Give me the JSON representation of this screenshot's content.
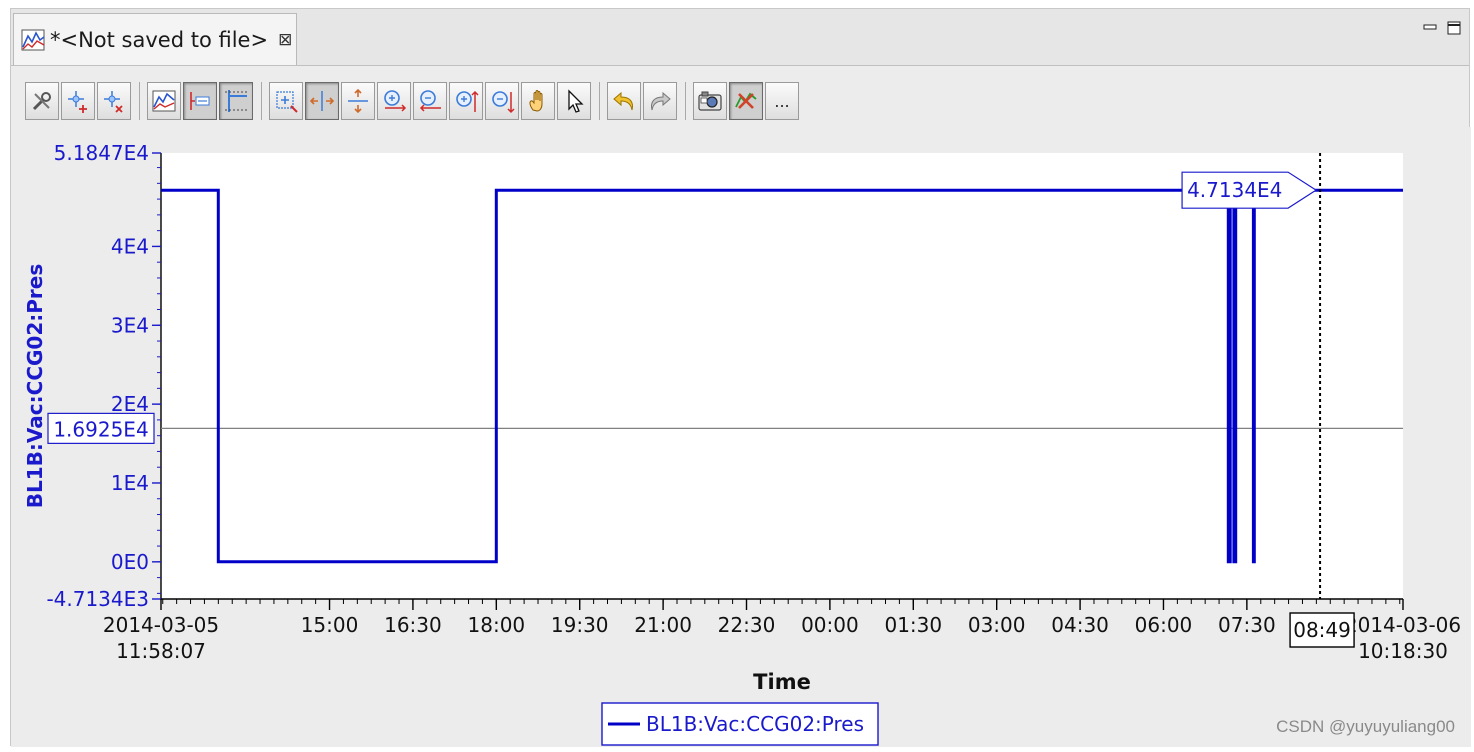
{
  "tab": {
    "title": "*<Not saved to file>",
    "close_glyph": "⊠"
  },
  "toolbar": {
    "more_label": "..."
  },
  "colors": {
    "trace": "#0000c8",
    "axis_text": "#1a1acc",
    "grid_line": "#808080"
  },
  "watermark": "CSDN @yuyuyuliang00",
  "chart_data": {
    "type": "line",
    "xlabel": "Time",
    "ylabel": "BL1B:Vac:CCG02:Pres",
    "ylim": [
      -4713.4,
      51847
    ],
    "y_ticks": [
      {
        "value": 51847,
        "label": "5.1847E4"
      },
      {
        "value": 40000,
        "label": "4E4"
      },
      {
        "value": 30000,
        "label": "3E4"
      },
      {
        "value": 20000,
        "label": "2E4"
      },
      {
        "value": 10000,
        "label": "1E4"
      },
      {
        "value": 0,
        "label": "0E0"
      },
      {
        "value": -4713.4,
        "label": "-4.7134E3"
      }
    ],
    "xlim": [
      "2014-03-05 11:58:07",
      "2014-03-06 10:18:30"
    ],
    "x_ticks": [
      {
        "time": "2014-03-05 11:58:07",
        "label": "2014-03-05",
        "label2": "11:58:07"
      },
      {
        "time": "2014-03-05 15:00",
        "label": "15:00"
      },
      {
        "time": "2014-03-05 16:30",
        "label": "16:30"
      },
      {
        "time": "2014-03-05 18:00",
        "label": "18:00"
      },
      {
        "time": "2014-03-05 19:30",
        "label": "19:30"
      },
      {
        "time": "2014-03-05 21:00",
        "label": "21:00"
      },
      {
        "time": "2014-03-05 22:30",
        "label": "22:30"
      },
      {
        "time": "2014-03-06 00:00",
        "label": "00:00"
      },
      {
        "time": "2014-03-06 01:30",
        "label": "01:30"
      },
      {
        "time": "2014-03-06 03:00",
        "label": "03:00"
      },
      {
        "time": "2014-03-06 04:30",
        "label": "04:30"
      },
      {
        "time": "2014-03-06 06:00",
        "label": "06:00"
      },
      {
        "time": "2014-03-06 07:30",
        "label": "07:30"
      },
      {
        "time": "2014-03-06 10:18:30",
        "label": "2014-03-06",
        "label2": "10:18:30"
      }
    ],
    "series": [
      {
        "name": "BL1B:Vac:CCG02:Pres",
        "color": "#0000c8",
        "points": [
          {
            "t": "2014-03-05 11:58:07",
            "y": 47134
          },
          {
            "t": "2014-03-05 13:00",
            "y": 47134
          },
          {
            "t": "2014-03-05 13:00",
            "y": 0
          },
          {
            "t": "2014-03-05 18:00",
            "y": 0
          },
          {
            "t": "2014-03-05 18:00",
            "y": 47134
          },
          {
            "t": "2014-03-06 07:10",
            "y": 47134
          },
          {
            "t": "2014-03-06 07:10",
            "y": 0
          },
          {
            "t": "2014-03-06 07:12",
            "y": 0
          },
          {
            "t": "2014-03-06 07:12",
            "y": 47134
          },
          {
            "t": "2014-03-06 07:16",
            "y": 47134
          },
          {
            "t": "2014-03-06 07:16",
            "y": 0
          },
          {
            "t": "2014-03-06 07:18",
            "y": 0
          },
          {
            "t": "2014-03-06 07:18",
            "y": 47134
          },
          {
            "t": "2014-03-06 07:37",
            "y": 47134
          },
          {
            "t": "2014-03-06 07:37",
            "y": 0
          },
          {
            "t": "2014-03-06 07:38",
            "y": 0
          },
          {
            "t": "2014-03-06 07:38",
            "y": 47134
          },
          {
            "t": "2014-03-06 10:18:30",
            "y": 47134
          }
        ]
      }
    ],
    "cursor_h": {
      "value": 16925,
      "label": "1.6925E4"
    },
    "cursor_v": {
      "time": "2014-03-06 08:49",
      "label": "08:49"
    },
    "cursor_value_label": "4.7134E4",
    "legend": {
      "placement": "bottom-center"
    },
    "grid": false
  }
}
